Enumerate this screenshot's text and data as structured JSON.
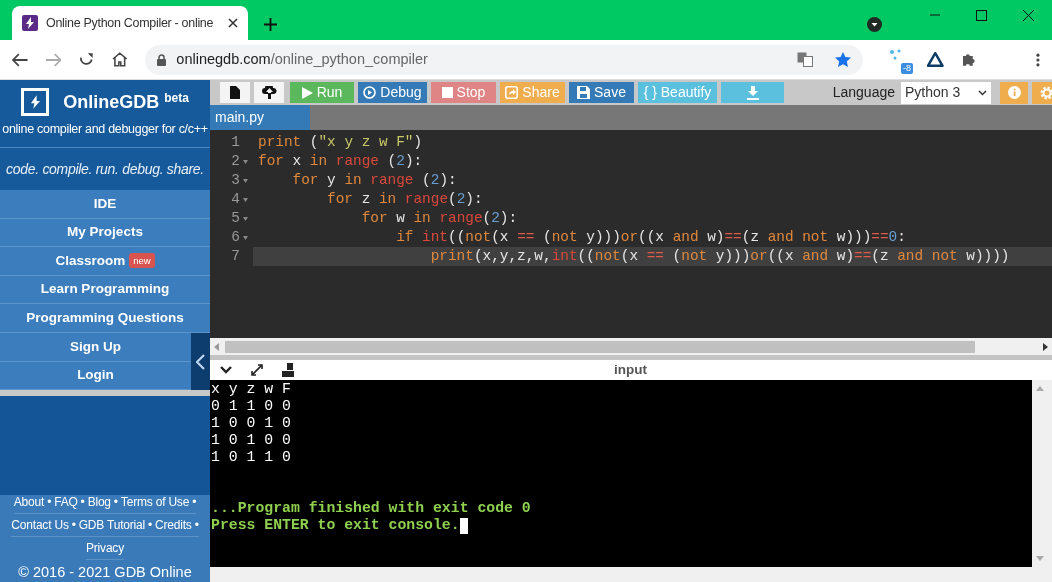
{
  "browser": {
    "tab_title": "Online Python Compiler - online",
    "url_host": "onlinegdb.com",
    "url_path": "/online_python_compiler",
    "extension_badge": "-8"
  },
  "sidebar": {
    "brand": "OnlineGDB",
    "brand_sup": "beta",
    "subtitle": "online compiler and debugger for c/c++",
    "tagline": "code. compile. run. debug. share.",
    "menu": [
      {
        "label": "IDE"
      },
      {
        "label": "My Projects"
      },
      {
        "label": "Classroom",
        "badge": "new"
      },
      {
        "label": "Learn Programming"
      },
      {
        "label": "Programming Questions"
      },
      {
        "label": "Sign Up"
      },
      {
        "label": "Login"
      }
    ],
    "footer_separator": "•",
    "footer_rows": [
      {
        "links": [
          "About",
          "FAQ",
          "Blog",
          "Terms of Use"
        ],
        "trailing_separator": true
      },
      {
        "links": [
          "Contact Us",
          "GDB Tutorial",
          "Credits"
        ],
        "trailing_separator": true
      },
      {
        "links": [
          "Privacy"
        ],
        "trailing_separator": false
      }
    ],
    "copyright": "© 2016 - 2021 GDB Online"
  },
  "toolbar": {
    "buttons": [
      {
        "kind": "plain",
        "disabled": false
      },
      {
        "kind": "plain",
        "disabled": false
      },
      {
        "kind": "success",
        "label": "Run",
        "disabled": false
      },
      {
        "kind": "primary",
        "label": "Debug",
        "disabled": false
      },
      {
        "kind": "danger",
        "label": "Stop",
        "disabled": true
      },
      {
        "kind": "warning",
        "label": "Share",
        "disabled": false
      },
      {
        "kind": "primary",
        "label": "Save",
        "disabled": false
      },
      {
        "kind": "info",
        "label": "{ } Beautify",
        "disabled": false
      },
      {
        "kind": "info",
        "disabled": false
      }
    ],
    "language_label": "Language",
    "language": "Python 3"
  },
  "file_tab": "main.py",
  "editor": {
    "lines": [
      {
        "number": "1",
        "fold": false,
        "active": false,
        "tokens": [
          {
            "text": "print",
            "kind": "kw"
          },
          {
            "text": " (",
            "kind": "plain"
          },
          {
            "text": "\"x y z w F\"",
            "kind": "str"
          },
          {
            "text": ")",
            "kind": "plain"
          }
        ]
      },
      {
        "number": "2",
        "fold": true,
        "active": false,
        "tokens": [
          {
            "text": "for",
            "kind": "kw"
          },
          {
            "text": " x ",
            "kind": "plain"
          },
          {
            "text": "in ",
            "kind": "kw"
          },
          {
            "text": "range",
            "kind": "fn"
          },
          {
            "text": " (",
            "kind": "plain"
          },
          {
            "text": "2",
            "kind": "num"
          },
          {
            "text": "):",
            "kind": "plain"
          }
        ]
      },
      {
        "number": "3",
        "fold": true,
        "active": false,
        "tokens": [
          {
            "text": "    for",
            "kind": "kw"
          },
          {
            "text": " y ",
            "kind": "plain"
          },
          {
            "text": "in ",
            "kind": "kw"
          },
          {
            "text": "range",
            "kind": "fn"
          },
          {
            "text": " (",
            "kind": "plain"
          },
          {
            "text": "2",
            "kind": "num"
          },
          {
            "text": "):",
            "kind": "plain"
          }
        ]
      },
      {
        "number": "4",
        "fold": true,
        "active": false,
        "tokens": [
          {
            "text": "        for",
            "kind": "kw"
          },
          {
            "text": " z ",
            "kind": "plain"
          },
          {
            "text": "in ",
            "kind": "kw"
          },
          {
            "text": "range",
            "kind": "fn"
          },
          {
            "text": "(",
            "kind": "plain"
          },
          {
            "text": "2",
            "kind": "num"
          },
          {
            "text": "):",
            "kind": "plain"
          }
        ]
      },
      {
        "number": "5",
        "fold": true,
        "active": false,
        "tokens": [
          {
            "text": "            for",
            "kind": "kw"
          },
          {
            "text": " w ",
            "kind": "plain"
          },
          {
            "text": "in ",
            "kind": "kw"
          },
          {
            "text": "range",
            "kind": "fn"
          },
          {
            "text": "(",
            "kind": "plain"
          },
          {
            "text": "2",
            "kind": "num"
          },
          {
            "text": "):",
            "kind": "plain"
          }
        ]
      },
      {
        "number": "6",
        "fold": true,
        "active": false,
        "tokens": [
          {
            "text": "                if ",
            "kind": "kw"
          },
          {
            "text": "int",
            "kind": "fn"
          },
          {
            "text": "((",
            "kind": "plain"
          },
          {
            "text": "not",
            "kind": "kw"
          },
          {
            "text": "(x ",
            "kind": "plain"
          },
          {
            "text": "==",
            "kind": "op"
          },
          {
            "text": " (",
            "kind": "plain"
          },
          {
            "text": "not",
            "kind": "kw"
          },
          {
            "text": " y)))",
            "kind": "plain"
          },
          {
            "text": "or",
            "kind": "kw"
          },
          {
            "text": "((x ",
            "kind": "plain"
          },
          {
            "text": "and",
            "kind": "kw"
          },
          {
            "text": " w)",
            "kind": "plain"
          },
          {
            "text": "==",
            "kind": "op"
          },
          {
            "text": "(z ",
            "kind": "plain"
          },
          {
            "text": "and not",
            "kind": "kw"
          },
          {
            "text": " w)))",
            "kind": "plain"
          },
          {
            "text": "==",
            "kind": "op"
          },
          {
            "text": "0",
            "kind": "num"
          },
          {
            "text": ":",
            "kind": "plain"
          }
        ]
      },
      {
        "number": "7",
        "fold": false,
        "active": true,
        "tokens": [
          {
            "text": "                    print",
            "kind": "kw"
          },
          {
            "text": "(x,y,z,w,",
            "kind": "plain"
          },
          {
            "text": "int",
            "kind": "fn"
          },
          {
            "text": "((",
            "kind": "plain"
          },
          {
            "text": "not",
            "kind": "kw"
          },
          {
            "text": "(x ",
            "kind": "plain"
          },
          {
            "text": "==",
            "kind": "op"
          },
          {
            "text": " (",
            "kind": "plain"
          },
          {
            "text": "not",
            "kind": "kw"
          },
          {
            "text": " y)))",
            "kind": "plain"
          },
          {
            "text": "or",
            "kind": "kw"
          },
          {
            "text": "((x ",
            "kind": "plain"
          },
          {
            "text": "and",
            "kind": "kw"
          },
          {
            "text": " w)",
            "kind": "plain"
          },
          {
            "text": "==",
            "kind": "op"
          },
          {
            "text": "(z ",
            "kind": "plain"
          },
          {
            "text": "and not",
            "kind": "kw"
          },
          {
            "text": " w))))",
            "kind": "plain"
          }
        ]
      }
    ]
  },
  "console": {
    "label": "input",
    "output": [
      "x y z w F",
      "0 1 1 0 0",
      "1 0 0 1 0",
      "1 0 1 0 0",
      "1 0 1 1 0"
    ],
    "status": [
      "...Program finished with exit code 0",
      "Press ENTER to exit console."
    ]
  }
}
